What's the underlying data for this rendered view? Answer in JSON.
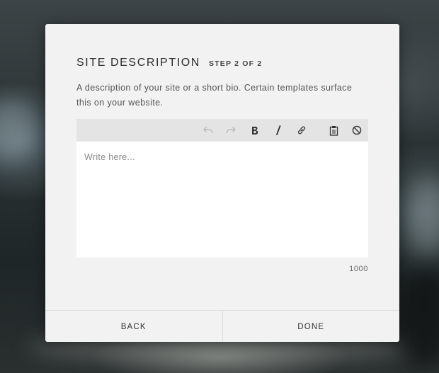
{
  "modal": {
    "title": "SITE DESCRIPTION",
    "step": "STEP 2 OF 2",
    "description": "A description of your site or a short bio. Certain templates surface this on your website."
  },
  "editor": {
    "placeholder": "Write here...",
    "value": "",
    "toolbar": [
      {
        "icon": "undo-icon",
        "enabled": false
      },
      {
        "icon": "redo-icon",
        "enabled": false
      },
      {
        "icon": "bold-icon",
        "enabled": true
      },
      {
        "icon": "italic-icon",
        "enabled": true
      },
      {
        "icon": "link-icon",
        "enabled": true
      },
      {
        "icon": "paste-icon",
        "enabled": true
      },
      {
        "icon": "clear-format-icon",
        "enabled": true
      }
    ],
    "char_remaining": "1000"
  },
  "footer": {
    "back_label": "BACK",
    "done_label": "DONE"
  },
  "colors": {
    "modal_bg": "#f2f2f2",
    "toolbar_bg": "#e4e4e4",
    "text_dark": "#2b2b2b",
    "icon_disabled": "#b5b5b5",
    "icon_enabled": "#333333"
  }
}
